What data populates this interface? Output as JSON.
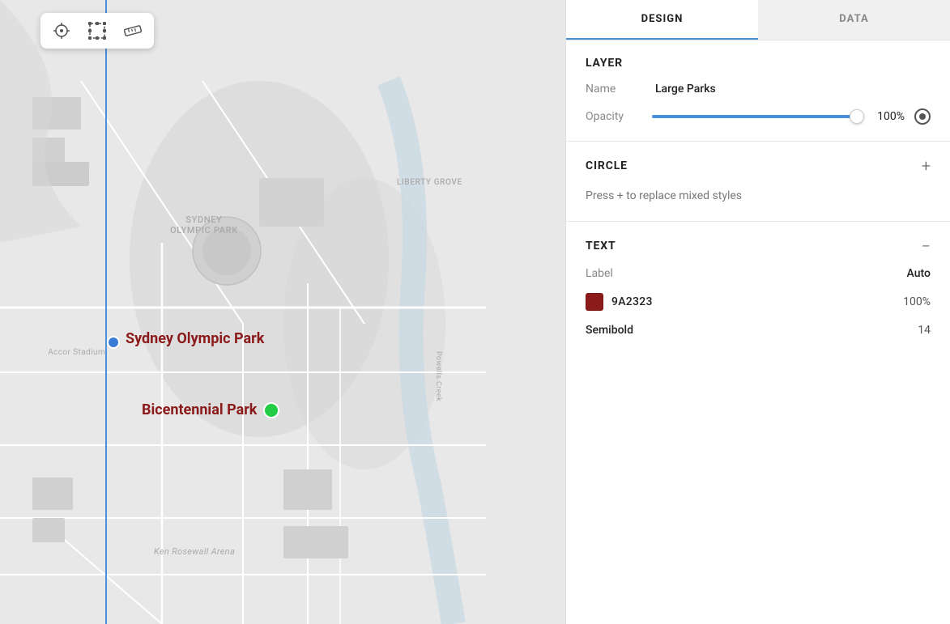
{
  "tabs": {
    "design": "DESIGN",
    "data": "DATA",
    "active": "design"
  },
  "toolbar": {
    "crosshair_icon": "⊕",
    "transform_icon": "⛶",
    "ruler_icon": "📏"
  },
  "layer": {
    "section_title": "LAYER",
    "name_label": "Name",
    "name_value": "Large Parks",
    "opacity_label": "Opacity",
    "opacity_value": "100%"
  },
  "circle": {
    "section_title": "CIRCLE",
    "add_icon": "+",
    "mixed_styles_text": "Press + to replace mixed styles"
  },
  "text": {
    "section_title": "TEXT",
    "minus_icon": "−",
    "label_label": "Label",
    "label_value": "Auto",
    "color_hex": "9A2323",
    "color_opacity": "100%",
    "font_style": "Semibold",
    "font_size": "14"
  },
  "map": {
    "sydney_olympic_line1": "SYDNEY",
    "sydney_olympic_line2": "OLYMPIC PARK",
    "liberty_grove": "LIBERTY GROVE",
    "park_name_sydney": "Sydney Olympic Park",
    "park_name_bicentennial": "Bicentennial Park",
    "accor_label": "Accor Stadium",
    "ken_label": "Ken Rosewall Arena",
    "powells_label": "Powells Creek"
  }
}
